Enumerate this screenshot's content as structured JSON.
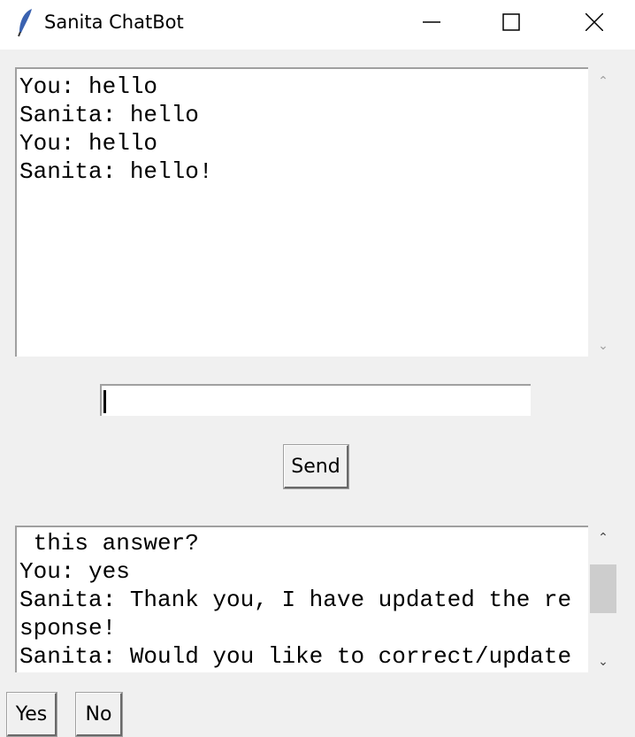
{
  "window": {
    "title": "Sanita ChatBot",
    "icon": "feather-icon"
  },
  "chat_log": {
    "lines": [
      "You: hello",
      "Sanita: hello",
      "You: hello",
      "Sanita: hello!"
    ]
  },
  "input": {
    "value": ""
  },
  "send_label": "Send",
  "feedback_log": {
    "lines": [
      " this answer?",
      "You: yes",
      "Sanita: Thank you, I have updated the re",
      "sponse!",
      "Sanita: Would you like to correct/update"
    ]
  },
  "yes_label": "Yes",
  "no_label": "No"
}
